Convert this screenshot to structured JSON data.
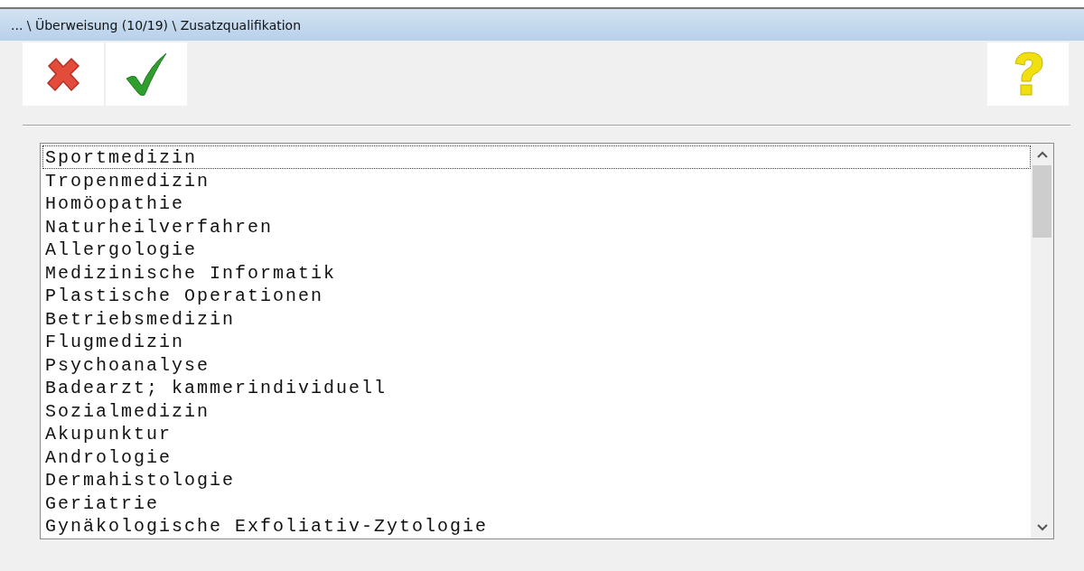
{
  "window": {
    "title": "... \\ Überweisung (10/19) \\ Zusatzqualifikation"
  },
  "toolbar": [
    {
      "kind": "cancel"
    },
    {
      "kind": "confirm"
    },
    {
      "kind": "help"
    }
  ],
  "list": {
    "items": [
      {
        "label": "Sportmedizin",
        "focused": true
      },
      {
        "label": "Tropenmedizin",
        "focused": false
      },
      {
        "label": "Homöopathie",
        "focused": false
      },
      {
        "label": "Naturheilverfahren",
        "focused": false
      },
      {
        "label": "Allergologie",
        "focused": false
      },
      {
        "label": "Medizinische Informatik",
        "focused": false
      },
      {
        "label": "Plastische Operationen",
        "focused": false
      },
      {
        "label": "Betriebsmedizin",
        "focused": false
      },
      {
        "label": "Flugmedizin",
        "focused": false
      },
      {
        "label": "Psychoanalyse",
        "focused": false
      },
      {
        "label": "Badearzt; kammerindividuell",
        "focused": false
      },
      {
        "label": "Sozialmedizin",
        "focused": false
      },
      {
        "label": "Akupunktur",
        "focused": false
      },
      {
        "label": "Andrologie",
        "focused": false
      },
      {
        "label": "Dermahistologie",
        "focused": false
      },
      {
        "label": "Geriatrie",
        "focused": false
      },
      {
        "label": "Gynäkologische Exfoliativ-Zytologie",
        "focused": false
      }
    ]
  }
}
